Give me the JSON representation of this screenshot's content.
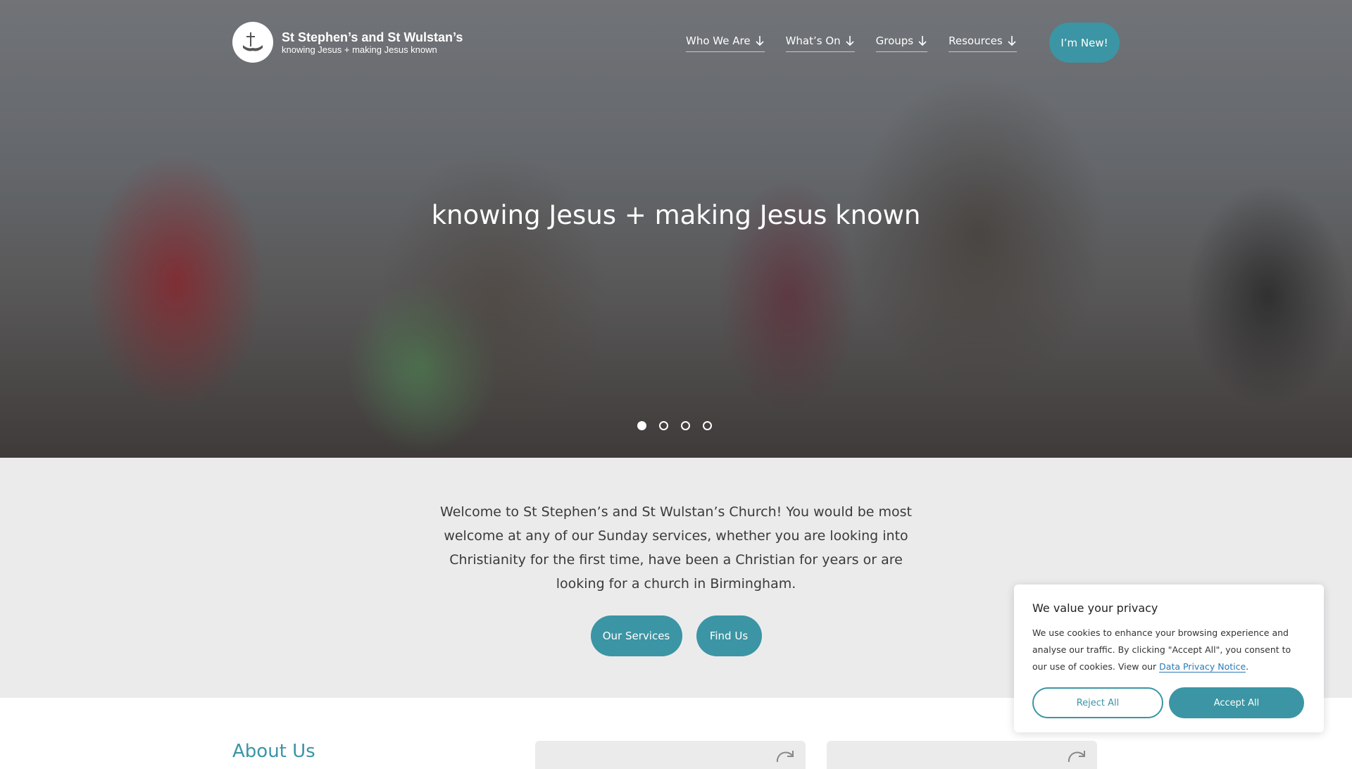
{
  "header": {
    "logo_title": "St Stephen’s and St Wulstan’s",
    "logo_tagline": "knowing Jesus + making Jesus known",
    "nav": [
      {
        "label": "Who We Are"
      },
      {
        "label": "What’s On"
      },
      {
        "label": "Groups"
      },
      {
        "label": "Resources"
      }
    ],
    "new_button": "I’m New!"
  },
  "hero": {
    "title": "knowing Jesus + making Jesus known",
    "slides_total": 4,
    "active_slide": 1
  },
  "welcome": {
    "text": "Welcome to St Stephen’s and St Wulstan’s Church! You would be most welcome at any of our Sunday services, whether you are looking into Christianity for the first time, have been a Christian for years or are looking for a church in Birmingham.",
    "buttons": [
      {
        "label": "Our Services"
      },
      {
        "label": "Find Us"
      }
    ]
  },
  "about": {
    "title": "About Us"
  },
  "cookie": {
    "title": "We value your privacy",
    "body": "We use cookies to enhance your browsing experience and analyse our traffic. By clicking \"Accept All\", you consent to our use of cookies. View our",
    "link": "Data Privacy Notice",
    "link_suffix": ".",
    "reject": "Reject All",
    "accept": "Accept All"
  },
  "colors": {
    "accent": "#3b95a4",
    "welcome_bg": "#ebebec",
    "link": "#2a7bb5"
  },
  "icons": {
    "logo": "cross-book-logo-icon",
    "nav_arrow": "arrow-down-icon",
    "card_icon": "refresh-icon"
  }
}
